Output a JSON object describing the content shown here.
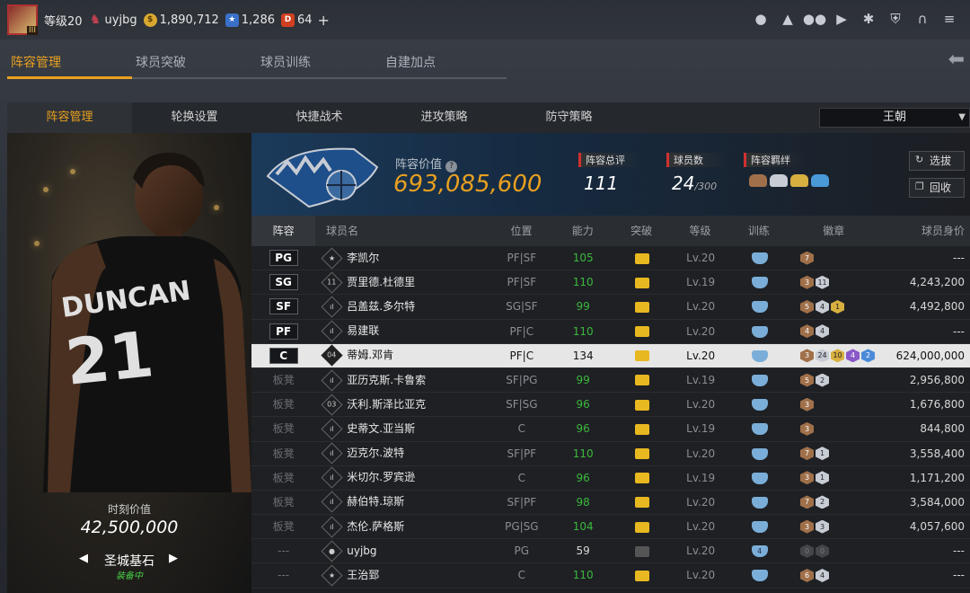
{
  "topbar": {
    "level": "等级20",
    "username": "uyjbg",
    "coins": "1,890,712",
    "stars": "1,286",
    "diamonds": "64",
    "plus": "+"
  },
  "main_tabs": [
    "阵容管理",
    "球员突破",
    "球员训练",
    "自建加点"
  ],
  "sub_tabs": [
    "阵容管理",
    "轮换设置",
    "快捷战术",
    "进攻策略",
    "防守策略"
  ],
  "dropdown": {
    "selected": "王朝"
  },
  "player_card": {
    "value_label": "时刻价值",
    "value": "42,500,000",
    "name": "圣城基石",
    "status": "装备中"
  },
  "team": {
    "value_label": "阵容价值",
    "value": "693,085,600",
    "stats": [
      {
        "label": "阵容总评",
        "value": "111",
        "suffix": ""
      },
      {
        "label": "球员数",
        "value": "24",
        "suffix": "/300"
      },
      {
        "label": "阵容羁绊",
        "value": "",
        "suffix": ""
      }
    ],
    "buttons": {
      "select": "选拔",
      "recycle": "回收"
    }
  },
  "table": {
    "headers": {
      "slot": "阵容",
      "name": "球员名",
      "position": "位置",
      "ability": "能力",
      "breakthrough": "突破",
      "level": "等级",
      "training": "训练",
      "badges": "徽章",
      "price": "球员身价"
    },
    "rows": [
      {
        "slot": "PG",
        "icon": "★",
        "name": "李凯尔",
        "position": "PF|SF",
        "ability": "105",
        "level": "Lv.20",
        "training": "",
        "badges": [
          [
            "b-bronze",
            "7"
          ]
        ],
        "price": "---",
        "starter": true
      },
      {
        "slot": "SG",
        "icon": "11",
        "name": "贾里德.杜德里",
        "position": "PF|SF",
        "ability": "110",
        "level": "Lv.19",
        "training": "",
        "badges": [
          [
            "b-bronze",
            "3"
          ],
          [
            "b-silver",
            "11"
          ]
        ],
        "price": "4,243,200",
        "starter": true
      },
      {
        "slot": "SF",
        "icon": "ıl",
        "name": "吕盖兹.多尔特",
        "position": "SG|SF",
        "ability": "99",
        "level": "Lv.20",
        "training": "",
        "badges": [
          [
            "b-bronze",
            "5"
          ],
          [
            "b-silver",
            "4"
          ],
          [
            "b-gold",
            "1"
          ]
        ],
        "price": "4,492,800",
        "starter": true
      },
      {
        "slot": "PF",
        "icon": "ıl",
        "name": "易建联",
        "position": "PF|C",
        "ability": "110",
        "level": "Lv.20",
        "training": "",
        "badges": [
          [
            "b-bronze",
            "4"
          ],
          [
            "b-silver",
            "4"
          ]
        ],
        "price": "---",
        "starter": true
      },
      {
        "slot": "C",
        "icon": "04",
        "name": "蒂姆.邓肯",
        "position": "PF|C",
        "ability": "134",
        "level": "Lv.20",
        "training": "",
        "badges": [
          [
            "b-bronze",
            "3"
          ],
          [
            "b-silver",
            "24"
          ],
          [
            "b-gold",
            "10"
          ],
          [
            "b-purple",
            "4"
          ],
          [
            "b-blue",
            "2"
          ]
        ],
        "price": "624,000,000",
        "starter": true,
        "selected": true
      },
      {
        "slot": "板凳",
        "icon": "ıl",
        "name": "亚历克斯.卡鲁索",
        "position": "SF|PG",
        "ability": "99",
        "level": "Lv.19",
        "training": "",
        "badges": [
          [
            "b-bronze",
            "5"
          ],
          [
            "b-silver",
            "2"
          ]
        ],
        "price": "2,956,800"
      },
      {
        "slot": "板凳",
        "icon": "03",
        "name": "沃利.斯泽比亚克",
        "position": "SF|SG",
        "ability": "96",
        "level": "Lv.20",
        "training": "",
        "badges": [
          [
            "b-bronze",
            "3"
          ]
        ],
        "price": "1,676,800"
      },
      {
        "slot": "板凳",
        "icon": "ıl",
        "name": "史蒂文.亚当斯",
        "position": "C",
        "ability": "96",
        "level": "Lv.19",
        "training": "",
        "badges": [
          [
            "b-bronze",
            "3"
          ]
        ],
        "price": "844,800"
      },
      {
        "slot": "板凳",
        "icon": "ıl",
        "name": "迈克尔.波特",
        "position": "SF|PF",
        "ability": "110",
        "level": "Lv.20",
        "training": "",
        "badges": [
          [
            "b-bronze",
            "7"
          ],
          [
            "b-silver",
            "1"
          ]
        ],
        "price": "3,558,400"
      },
      {
        "slot": "板凳",
        "icon": "ıl",
        "name": "米切尔.罗宾逊",
        "position": "C",
        "ability": "96",
        "level": "Lv.19",
        "training": "",
        "badges": [
          [
            "b-bronze",
            "3"
          ],
          [
            "b-silver",
            "1"
          ]
        ],
        "price": "1,171,200"
      },
      {
        "slot": "板凳",
        "icon": "ıl",
        "name": "赫伯特.琼斯",
        "position": "SF|PF",
        "ability": "98",
        "level": "Lv.20",
        "training": "",
        "badges": [
          [
            "b-bronze",
            "7"
          ],
          [
            "b-silver",
            "2"
          ]
        ],
        "price": "3,584,000"
      },
      {
        "slot": "板凳",
        "icon": "ıl",
        "name": "杰伦.萨格斯",
        "position": "PG|SG",
        "ability": "104",
        "level": "Lv.20",
        "training": "",
        "badges": [
          [
            "b-bronze",
            "3"
          ],
          [
            "b-silver",
            "3"
          ]
        ],
        "price": "4,057,600"
      },
      {
        "slot": "---",
        "icon": "●",
        "name": "uyjbg",
        "position": "PG",
        "ability": "59",
        "level": "Lv.20",
        "training": "4",
        "badges": [
          [
            "b-dark",
            "0"
          ],
          [
            "b-dark",
            "0"
          ]
        ],
        "price": "---",
        "self": true
      },
      {
        "slot": "---",
        "icon": "★",
        "name": "王治郅",
        "position": "C",
        "ability": "110",
        "level": "Lv.20",
        "training": "",
        "badges": [
          [
            "b-bronze",
            "6"
          ],
          [
            "b-silver",
            "4"
          ]
        ],
        "price": "---"
      }
    ]
  },
  "colors": {
    "accent": "#e8a020",
    "green": "#3cb83c"
  }
}
